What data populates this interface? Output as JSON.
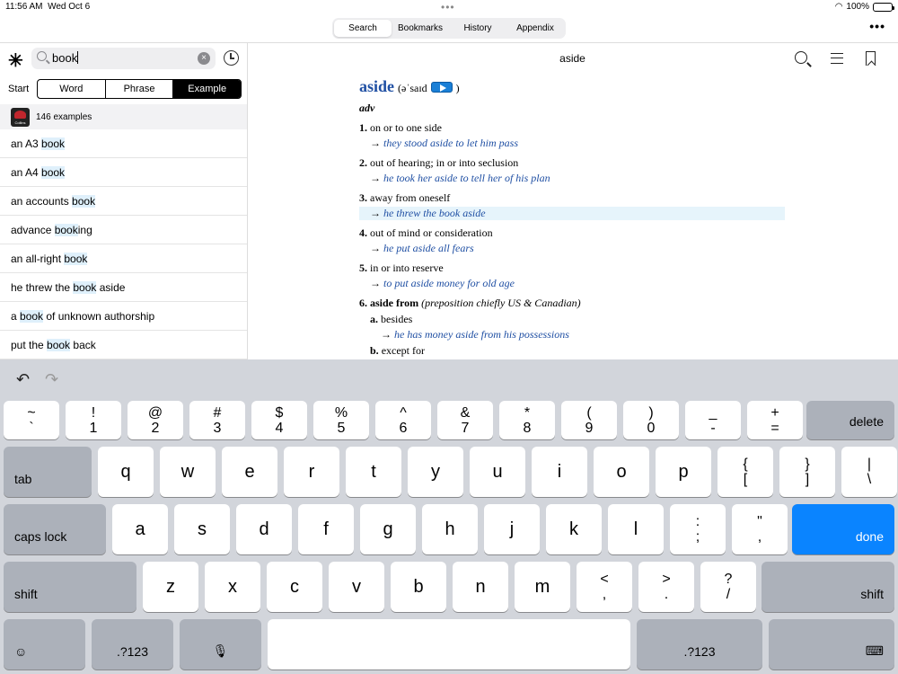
{
  "status": {
    "time": "11:56 AM",
    "date": "Wed Oct 6",
    "battery": "100%"
  },
  "tabs": [
    "Search",
    "Bookmarks",
    "History",
    "Appendix"
  ],
  "active_tab": "Search",
  "search": {
    "query": "book",
    "clear": "×"
  },
  "filter": {
    "start_label": "Start",
    "options": [
      "Word",
      "Phrase",
      "Example"
    ],
    "active": "Example"
  },
  "results": {
    "count_text": "146 examples",
    "logo_text": "Collins",
    "rows": [
      {
        "pre": "an A3 ",
        "hl": "book",
        "post": ""
      },
      {
        "pre": "an A4 ",
        "hl": "book",
        "post": ""
      },
      {
        "pre": "an accounts ",
        "hl": "book",
        "post": ""
      },
      {
        "pre": "advance ",
        "hl": "book",
        "post": "ing"
      },
      {
        "pre": "an all-right ",
        "hl": "book",
        "post": ""
      },
      {
        "pre": "he threw the ",
        "hl": "book",
        "post": " aside"
      },
      {
        "pre": "a ",
        "hl": "book",
        "post": " of unknown authorship"
      },
      {
        "pre": "put the ",
        "hl": "book",
        "post": " back"
      }
    ]
  },
  "entry": {
    "title": "aside",
    "headword": "aside",
    "pron": "(əˈsaɪd",
    "pron_close": ")",
    "pos": "adv",
    "arrow": "→",
    "senses": [
      {
        "n": "1.",
        "def": "on or to one side",
        "ex": "they stood aside to let him pass"
      },
      {
        "n": "2.",
        "def": "out of hearing; in or into seclusion",
        "ex": "he took her aside to tell her of his plan"
      },
      {
        "n": "3.",
        "def": "away from oneself",
        "ex": "he threw the book aside"
      },
      {
        "n": "4.",
        "def": "out of mind or consideration",
        "ex": "he put aside all fears"
      },
      {
        "n": "5.",
        "def": "in or into reserve",
        "ex": "to put aside money for old age"
      }
    ],
    "sense6": {
      "n": "6.",
      "head": "aside from",
      "note": "(preposition chiefly US & Canadian)"
    },
    "sub_a": {
      "n": "a.",
      "def": "besides",
      "ex": "he has money aside from his possessions"
    },
    "sub_b": {
      "n": "b.",
      "def": "except for"
    }
  },
  "keyboard": {
    "undo": "↶",
    "redo": "↷",
    "row1": [
      [
        "~",
        "`"
      ],
      [
        "!",
        "1"
      ],
      [
        "@",
        "2"
      ],
      [
        "#",
        "3"
      ],
      [
        "$",
        "4"
      ],
      [
        "%",
        "5"
      ],
      [
        "^",
        "6"
      ],
      [
        "&",
        "7"
      ],
      [
        "*",
        "8"
      ],
      [
        "(",
        "9"
      ],
      [
        ")",
        "0"
      ],
      [
        "_",
        "-"
      ],
      [
        "+",
        "="
      ]
    ],
    "delete": "delete",
    "tab": "tab",
    "row2": [
      "q",
      "w",
      "e",
      "r",
      "t",
      "y",
      "u",
      "i",
      "o",
      "p"
    ],
    "row2_sym": [
      [
        "{",
        "["
      ],
      [
        "}",
        "]"
      ],
      [
        "|",
        "\\"
      ]
    ],
    "caps": "caps lock",
    "row3": [
      "a",
      "s",
      "d",
      "f",
      "g",
      "h",
      "j",
      "k",
      "l"
    ],
    "row3_sym": [
      [
        ":",
        ";"
      ],
      [
        "\"",
        ","
      ]
    ],
    "done": "done",
    "shift": "shift",
    "row4": [
      "z",
      "x",
      "c",
      "v",
      "b",
      "n",
      "m"
    ],
    "row4_sym": [
      [
        "<",
        ","
      ],
      [
        ">",
        "."
      ],
      [
        "?",
        "/"
      ]
    ],
    "emoji": "☺",
    "num": ".?123",
    "mic": "🎙",
    "kbd": "⌨"
  }
}
